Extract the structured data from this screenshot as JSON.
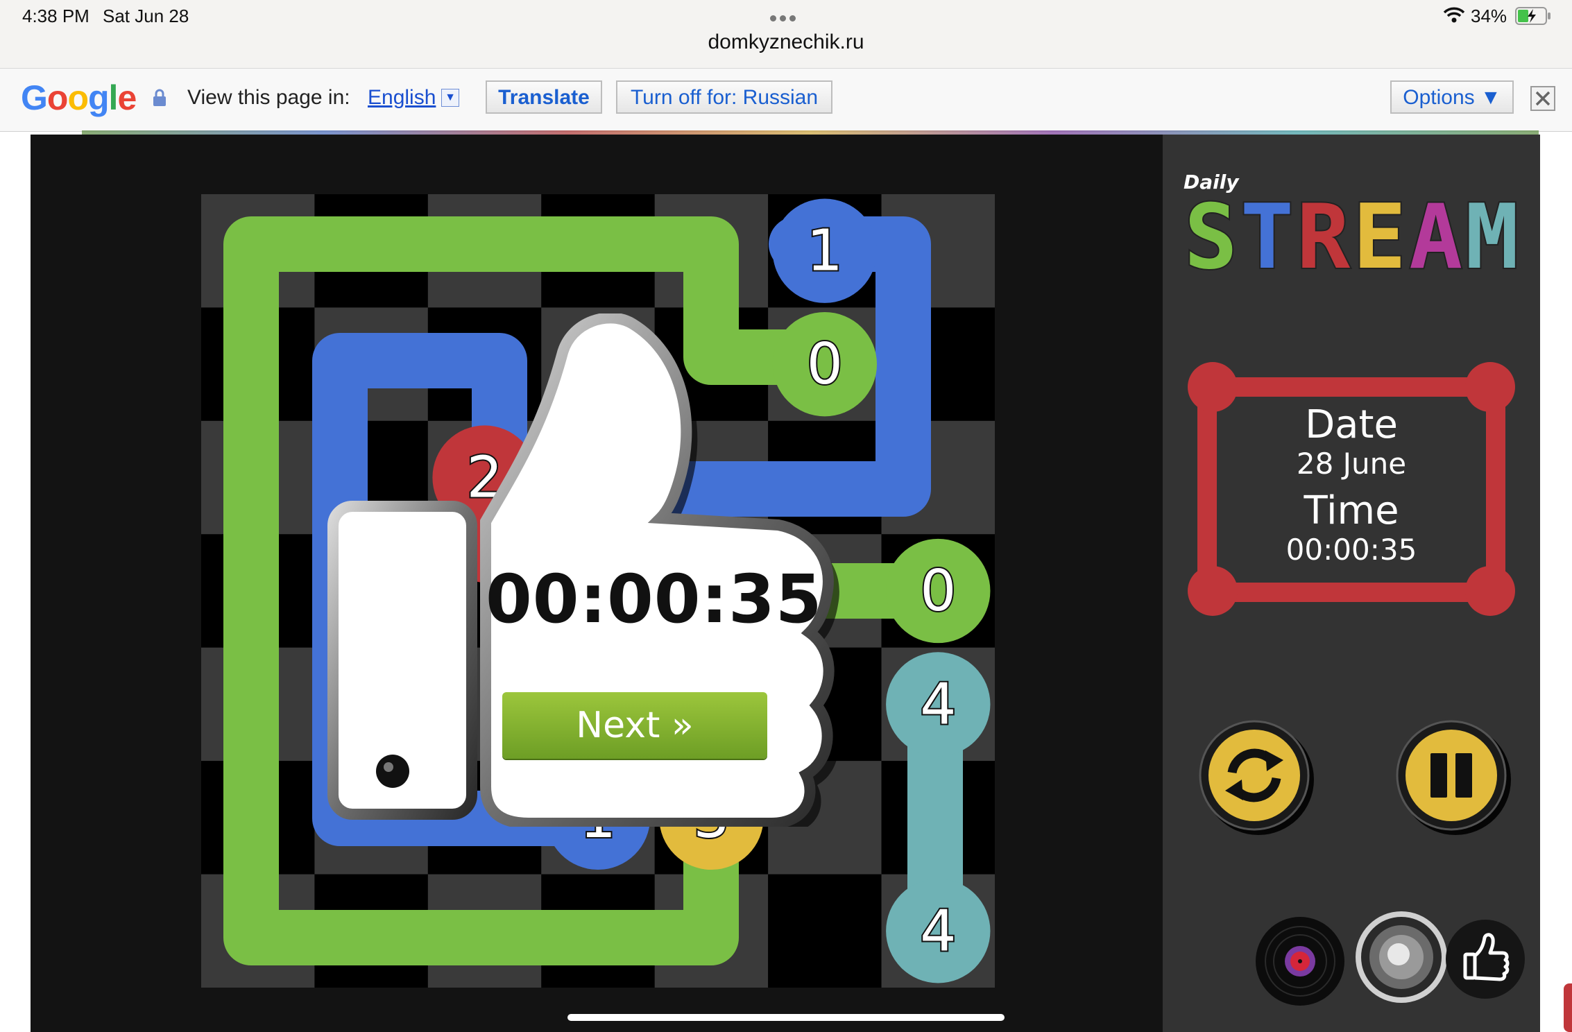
{
  "status_bar": {
    "time": "4:38 PM",
    "date": "Sat Jun 28",
    "battery": "34%",
    "url": "domkyznechik.ru"
  },
  "translate_bar": {
    "logo": "Google",
    "prompt": "View this page in:",
    "language": "English",
    "translate_label": "Translate",
    "turn_off_label": "Turn off for: Russian",
    "options_label": "Options ▼",
    "close_icon": "close-icon"
  },
  "game": {
    "logo_daily": "Daily",
    "logo_stream": "STREAM",
    "date_label": "Date",
    "date_value": "28 June",
    "time_label": "Time",
    "time_value": "00:00:35",
    "popup_time": "00:00:35",
    "next_label": "Next »",
    "board": {
      "rows": 7,
      "cols": 7,
      "nodes": [
        {
          "label": "1",
          "row": 0,
          "col": 5,
          "color": "#4472d6"
        },
        {
          "label": "0",
          "row": 1,
          "col": 5,
          "color": "#7abf45"
        },
        {
          "label": "2",
          "row": 2,
          "col": 2,
          "color": "#c0363a"
        },
        {
          "label": "0",
          "row": 3,
          "col": 6,
          "color": "#7abf45"
        },
        {
          "label": "4",
          "row": 4,
          "col": 6,
          "color": "#6fb2b5"
        },
        {
          "label": "1",
          "row": 5,
          "col": 3,
          "color": "#4472d6"
        },
        {
          "label": "3",
          "row": 5,
          "col": 4,
          "color": "#e2bb3d"
        },
        {
          "label": "4",
          "row": 6,
          "col": 6,
          "color": "#6fb2b5"
        }
      ]
    },
    "colors": {
      "green": "#7abf45",
      "blue": "#4472d6",
      "red": "#c0363a",
      "teal": "#6fb2b5",
      "yellow": "#e2bb3d"
    }
  }
}
